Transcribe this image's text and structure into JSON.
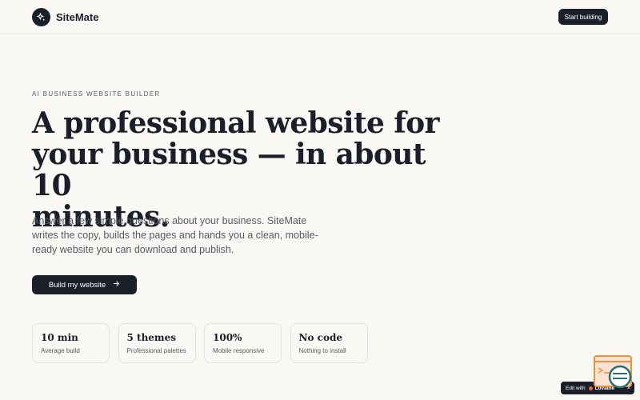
{
  "header": {
    "brand": "SiteMate",
    "cta_label": "Start building"
  },
  "hero": {
    "eyebrow": "AI BUSINESS WEBSITE BUILDER",
    "headline_line1": "A professional website for",
    "headline_line2": "your business — in about 10",
    "headline_line3": "minutes.",
    "lead": "Answer a few simple questions about your business. SiteMate writes the copy, builds the pages and hands you a clean, mobile-ready website you can download and publish.",
    "cta_label": "Build my website",
    "cta_icon": "arrow-right-icon"
  },
  "stats": [
    {
      "value": "10 min",
      "label": "Average build"
    },
    {
      "value": "5 themes",
      "label": "Professional palettes"
    },
    {
      "value": "100%",
      "label": "Mobile responsive"
    },
    {
      "value": "No code",
      "label": "Nothing to install"
    }
  ],
  "edit_badge": {
    "prefix": "Edit with",
    "brand": "Lovable",
    "close": "×"
  },
  "colors": {
    "background": "#f9f8f5",
    "primary": "#1b1f2a",
    "muted_text": "#555a63",
    "accent_orange": "#e8663a",
    "widget_teal": "#2c6e7a"
  }
}
